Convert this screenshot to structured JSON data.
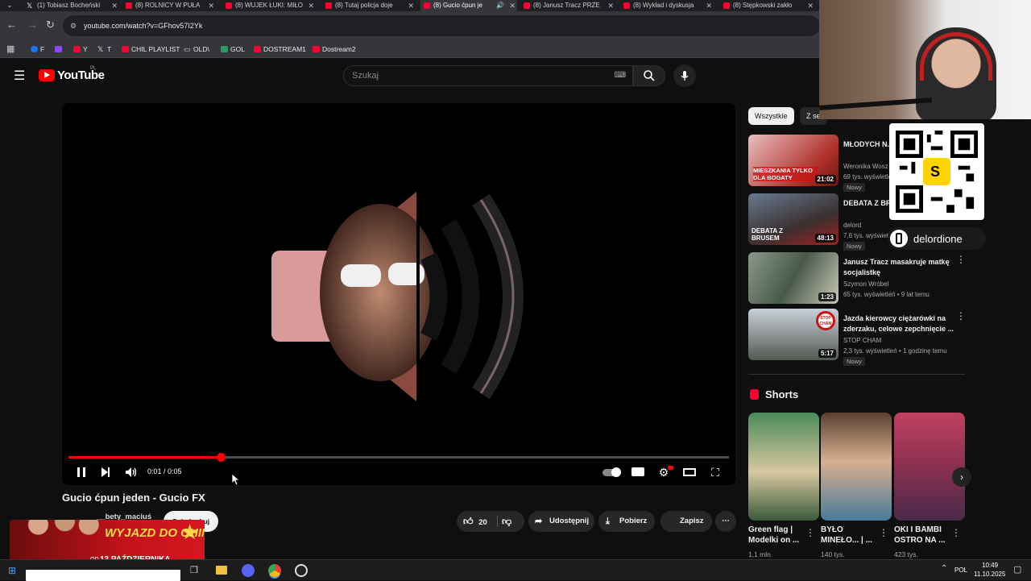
{
  "tabs": [
    {
      "label": "(1) Tobiasz Bocheński",
      "icon": "x-icon"
    },
    {
      "label": "(8) ROLNICY W PUŁA",
      "icon": "youtube-icon"
    },
    {
      "label": "(8) WUJEK ŁUKI: MIŁO",
      "icon": "youtube-icon"
    },
    {
      "label": "(8) Tutaj policja doje",
      "icon": "youtube-icon"
    },
    {
      "label": "(8) Gucio ćpun je",
      "icon": "youtube-icon"
    },
    {
      "label": "(8) Janusz Tracz PRZE",
      "icon": "youtube-icon"
    },
    {
      "label": "(8) Wykład i dyskusja",
      "icon": "youtube-icon"
    },
    {
      "label": "(8) Stępkowski zakło",
      "icon": "youtube-icon"
    }
  ],
  "url": "youtube.com/watch?v=GFhov57I2Yk",
  "bookmarks": [
    {
      "label": "F"
    },
    {
      "label": ""
    },
    {
      "label": "Y"
    },
    {
      "label": "T"
    },
    {
      "label": "CHIL PLAYLIST"
    },
    {
      "label": "OLD\\"
    },
    {
      "label": "GOL"
    },
    {
      "label": "DOSTREAM1"
    },
    {
      "label": "Dostream2"
    }
  ],
  "yt": {
    "logo_text": "YouTube",
    "region": "PL",
    "search_placeholder": "Szukaj"
  },
  "player": {
    "time": "0:01 / 0:05",
    "progress": 0.23
  },
  "video": {
    "title": "Gucio ćpun jeden - Gucio FX",
    "channel": "__bety_maciuś",
    "subscribe": "Subskrybuj",
    "likes": "20",
    "share": "Udostępnij",
    "download": "Pobierz",
    "save": "Zapisz"
  },
  "chips": [
    "Wszystkie",
    "Z se"
  ],
  "recommendations": [
    {
      "title": "MŁODYCH N... MIESZKANIA",
      "channel": "Weronika Wosz",
      "meta": "69 tys. wyświetleń",
      "badge": "Nowy",
      "duration": "21:02",
      "thumb_text": "MIESZKANIA TYLKO DLA BOGATY"
    },
    {
      "title": "DEBATA Z BR... NARCYZM, A",
      "channel": "delord",
      "meta": "7,6 tys. wyświetl",
      "badge": "Nowy",
      "duration": "48:13",
      "thumb_text": "DEBATA Z BRUSEM"
    },
    {
      "title": "Janusz Tracz masakruje matkę socjalistkę",
      "channel": "Szymon Wróbel",
      "meta": "65 tys. wyświetleń • 9 lat temu",
      "badge": "",
      "duration": "1:23",
      "thumb_text": ""
    },
    {
      "title": "Jazda kierowcy ciężarówki na zderzaku, celowe zepchnięcie ...",
      "channel": "STOP CHAM",
      "meta": "2,3 tys. wyświetleń • 1 godzinę temu",
      "badge": "Nowy",
      "duration": "5:17",
      "thumb_text": "STOP CHAM"
    }
  ],
  "shorts_heading": "Shorts",
  "shorts": [
    {
      "title": "Green flag | Modelki on ...",
      "views": "1,1 mln"
    },
    {
      "title": "BYŁO MINEŁO... | ...",
      "views": "140 tys."
    },
    {
      "title": "OKI I BAMBI OSTRO NA ...",
      "views": "423 tys."
    }
  ],
  "overlay": {
    "qr_handle": "delordione",
    "promo_title": "WYJAZD DO CHIN",
    "promo_date": "13 PAŹDZIERNIKA",
    "promo_badge": "OD"
  },
  "taskbar": {
    "lang": "POL",
    "time": "10:49",
    "date": "11.10.2025"
  },
  "colors": {
    "accent": "#ff0000",
    "background": "#0f0f0f"
  }
}
